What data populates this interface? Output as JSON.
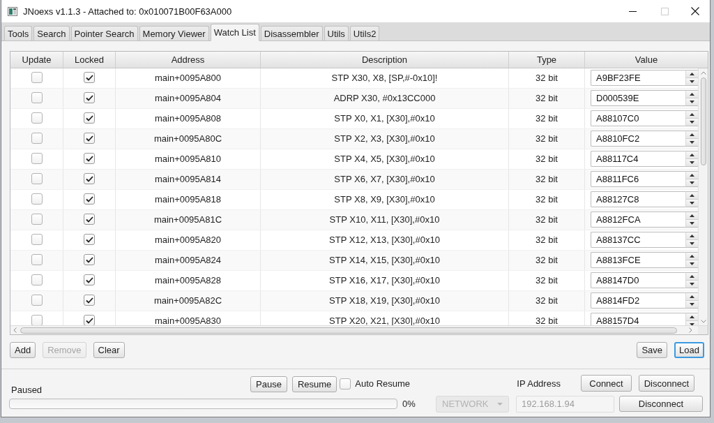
{
  "window": {
    "title": "JNoexs v1.1.3 - Attached to: 0x010071B00F63A000",
    "controls": [
      {
        "kind": "minimize",
        "disabled": false
      },
      {
        "kind": "maximize",
        "disabled": true
      },
      {
        "kind": "close",
        "disabled": false
      }
    ]
  },
  "tabs": [
    {
      "label": "Tools",
      "selected": false
    },
    {
      "label": "Search",
      "selected": false
    },
    {
      "label": "Pointer Search",
      "selected": false
    },
    {
      "label": "Memory Viewer",
      "selected": false
    },
    {
      "label": "Watch List",
      "selected": true
    },
    {
      "label": "Disassembler",
      "selected": false
    },
    {
      "label": "Utils",
      "selected": false
    },
    {
      "label": "Utils2",
      "selected": false
    }
  ],
  "watch_list": {
    "columns": [
      "Update",
      "Locked",
      "Address",
      "Description",
      "Type",
      "Value"
    ],
    "rows": [
      {
        "update": false,
        "locked": true,
        "address": "main+0095A800",
        "description": "STP X30, X8, [SP,#-0x10]!",
        "type": "32 bit",
        "value": "A9BF23FE"
      },
      {
        "update": false,
        "locked": true,
        "address": "main+0095A804",
        "description": "ADRP X30, #0x13CC000",
        "type": "32 bit",
        "value": "D000539E"
      },
      {
        "update": false,
        "locked": true,
        "address": "main+0095A808",
        "description": "STP X0, X1, [X30],#0x10",
        "type": "32 bit",
        "value": "A88107C0"
      },
      {
        "update": false,
        "locked": true,
        "address": "main+0095A80C",
        "description": "STP X2, X3, [X30],#0x10",
        "type": "32 bit",
        "value": "A8810FC2"
      },
      {
        "update": false,
        "locked": true,
        "address": "main+0095A810",
        "description": "STP X4, X5, [X30],#0x10",
        "type": "32 bit",
        "value": "A88117C4"
      },
      {
        "update": false,
        "locked": true,
        "address": "main+0095A814",
        "description": "STP X6, X7, [X30],#0x10",
        "type": "32 bit",
        "value": "A8811FC6"
      },
      {
        "update": false,
        "locked": true,
        "address": "main+0095A818",
        "description": "STP X8, X9, [X30],#0x10",
        "type": "32 bit",
        "value": "A88127C8"
      },
      {
        "update": false,
        "locked": true,
        "address": "main+0095A81C",
        "description": "STP X10, X11, [X30],#0x10",
        "type": "32 bit",
        "value": "A8812FCA"
      },
      {
        "update": false,
        "locked": true,
        "address": "main+0095A820",
        "description": "STP X12, X13, [X30],#0x10",
        "type": "32 bit",
        "value": "A88137CC"
      },
      {
        "update": false,
        "locked": true,
        "address": "main+0095A824",
        "description": "STP X14, X15, [X30],#0x10",
        "type": "32 bit",
        "value": "A8813FCE"
      },
      {
        "update": false,
        "locked": true,
        "address": "main+0095A828",
        "description": "STP X16, X17, [X30],#0x10",
        "type": "32 bit",
        "value": "A88147D0"
      },
      {
        "update": false,
        "locked": true,
        "address": "main+0095A82C",
        "description": "STP X18, X19, [X30],#0x10",
        "type": "32 bit",
        "value": "A8814FD2"
      },
      {
        "update": false,
        "locked": true,
        "address": "main+0095A830",
        "description": "STP X20, X21, [X30],#0x10",
        "type": "32 bit",
        "value": "A88157D4"
      }
    ]
  },
  "list_buttons": [
    {
      "label": "Add",
      "disabled": false
    },
    {
      "label": "Remove",
      "disabled": true
    },
    {
      "label": "Clear",
      "disabled": false
    }
  ],
  "file_buttons": [
    {
      "label": "Save",
      "focused": false
    },
    {
      "label": "Load",
      "focused": true
    }
  ],
  "status": {
    "label": "Paused",
    "buttons": [
      {
        "label": "Pause"
      },
      {
        "label": "Resume"
      }
    ],
    "auto_resume": {
      "label": "Auto Resume",
      "checked": false
    },
    "progress": {
      "level": 0,
      "reading": "0%"
    }
  },
  "connection": {
    "ip_label": "IP Address",
    "buttons": [
      {
        "label": "Connect"
      },
      {
        "label": "Disconnect"
      }
    ],
    "mode": {
      "value": "NETWORK",
      "disabled": true
    },
    "ip_field": {
      "value": "192.168.1.94",
      "disabled": true
    },
    "disconnect_button": {
      "label": "Disconnect"
    }
  }
}
